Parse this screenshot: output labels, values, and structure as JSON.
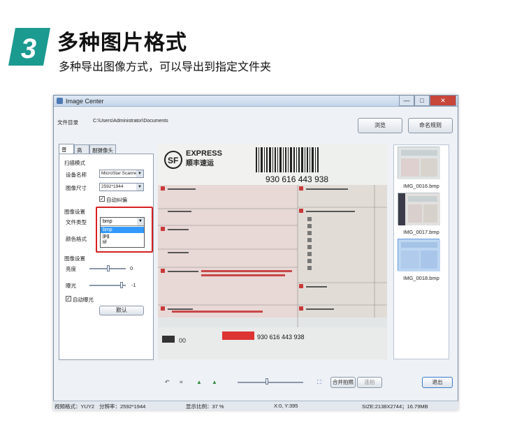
{
  "header": {
    "badge_number": "3",
    "title": "多种图片格式",
    "subtitle": "多种导出图像方式，可以导出到指定文件夹"
  },
  "window": {
    "title": "Image Center",
    "controls": {
      "minimize": "—",
      "maximize": "□",
      "close": "✕"
    }
  },
  "toolbar": {
    "dir_label": "文件目录",
    "dir_path": "C:\\Users\\Administrator\\Documents",
    "browse_label": "浏览",
    "naming_label": "命名规则"
  },
  "panel": {
    "tabs": [
      "普通",
      "高级",
      "副摄像头"
    ],
    "scan_mode_heading": "扫描模式",
    "device_label": "设备名称",
    "device_value": "MicroStar Scanne",
    "size_label": "图像尺寸",
    "size_value": "2592*1944",
    "auto_correct_label": "自动纠偏",
    "image_settings_heading": "图像设置",
    "file_type_label": "文件类型",
    "file_type_value": "bmp",
    "file_type_options": [
      "bmp",
      "jpg",
      "tif"
    ],
    "color_label": "颜色格式",
    "image_adjust_heading": "图像设置",
    "brightness_label": "亮度",
    "brightness_value": "0",
    "exposure_label": "曝光",
    "exposure_value": "-1",
    "auto_exposure_label": "自动曝光",
    "default_button": "默认"
  },
  "preview": {
    "brand": "EXPRESS",
    "brand_cn": "顺丰速运",
    "tracking_number": "930 616 443 938",
    "tracking_bottom": "930 616 443 938"
  },
  "thumbnails": [
    {
      "name": "IMG_0016.bmp"
    },
    {
      "name": "IMG_0017.bmp"
    },
    {
      "name": "IMG_0018.bmp"
    }
  ],
  "bottom": {
    "merge_label": "合并拍照",
    "splice_label": "连拍",
    "exit_label": "退出"
  },
  "status": {
    "video_format": "视频格式：YUY2",
    "resolution": "分辨率：2592*1944",
    "zoom": "显示比例：37 %",
    "coords": "X:0, Y:395",
    "size": "SIZE:2138X2744；16.79MB"
  }
}
